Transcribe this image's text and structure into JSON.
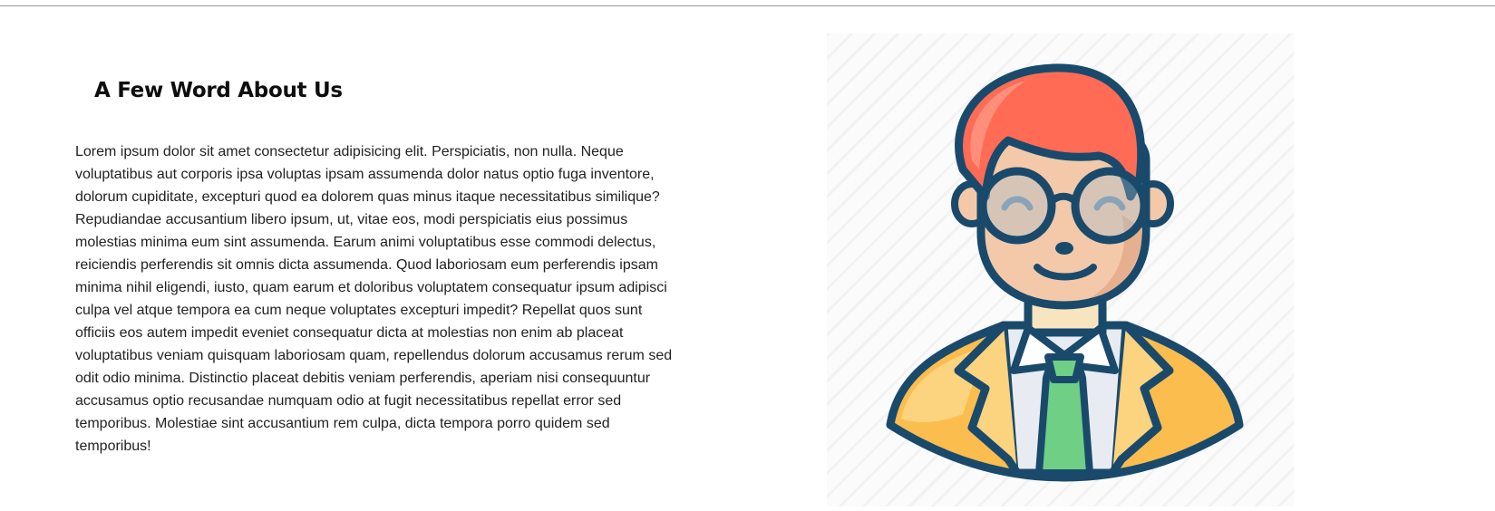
{
  "about": {
    "heading": "A Few Word About Us",
    "body": "Lorem ipsum dolor sit amet consectetur adipisicing elit. Perspiciatis, non nulla. Neque voluptatibus aut corporis ipsa voluptas ipsam assumenda dolor natus optio fuga inventore, dolorum cupiditate, excepturi quod ea dolorem quas minus itaque necessitatibus similique? Repudiandae accusantium libero ipsum, ut, vitae eos, modi perspiciatis eius possimus molestias minima eum sint assumenda. Earum animi voluptatibus esse commodi delectus, reiciendis perferendis sit omnis dicta assumenda. Quod laboriosam eum perferendis ipsam minima nihil eligendi, iusto, quam earum et doloribus voluptatem consequatur ipsum adipisci culpa vel atque tempora ea cum neque voluptates excepturi impedit? Repellat quos sunt officiis eos autem impedit eveniet consequatur dicta at molestias non enim ab placeat voluptatibus veniam quisquam laboriosam quam, repellendus dolorum accusamus rerum sed odit odio minima. Distinctio placeat debitis veniam perferendis, aperiam nisi consequuntur accusamus optio recusandae numquam odio at fugit necessitatibus repellat error sed temporibus. Molestiae sint accusantium rem culpa, dicta tempora porro quidem sed temporibus!"
  },
  "illustration": {
    "subject": "businessman-avatar",
    "colors": {
      "outline": "#1a4a6b",
      "hair": "#ff6b55",
      "hair_highlight": "#ff8f7a",
      "skin": "#f3c9a9",
      "skin_shadow": "#e6b08e",
      "jacket": "#fbbd4e",
      "jacket_light": "#fcd37e",
      "shirt": "#e8ecf2",
      "tie": "#6fcf85",
      "neck": "#f8e5bf"
    }
  }
}
